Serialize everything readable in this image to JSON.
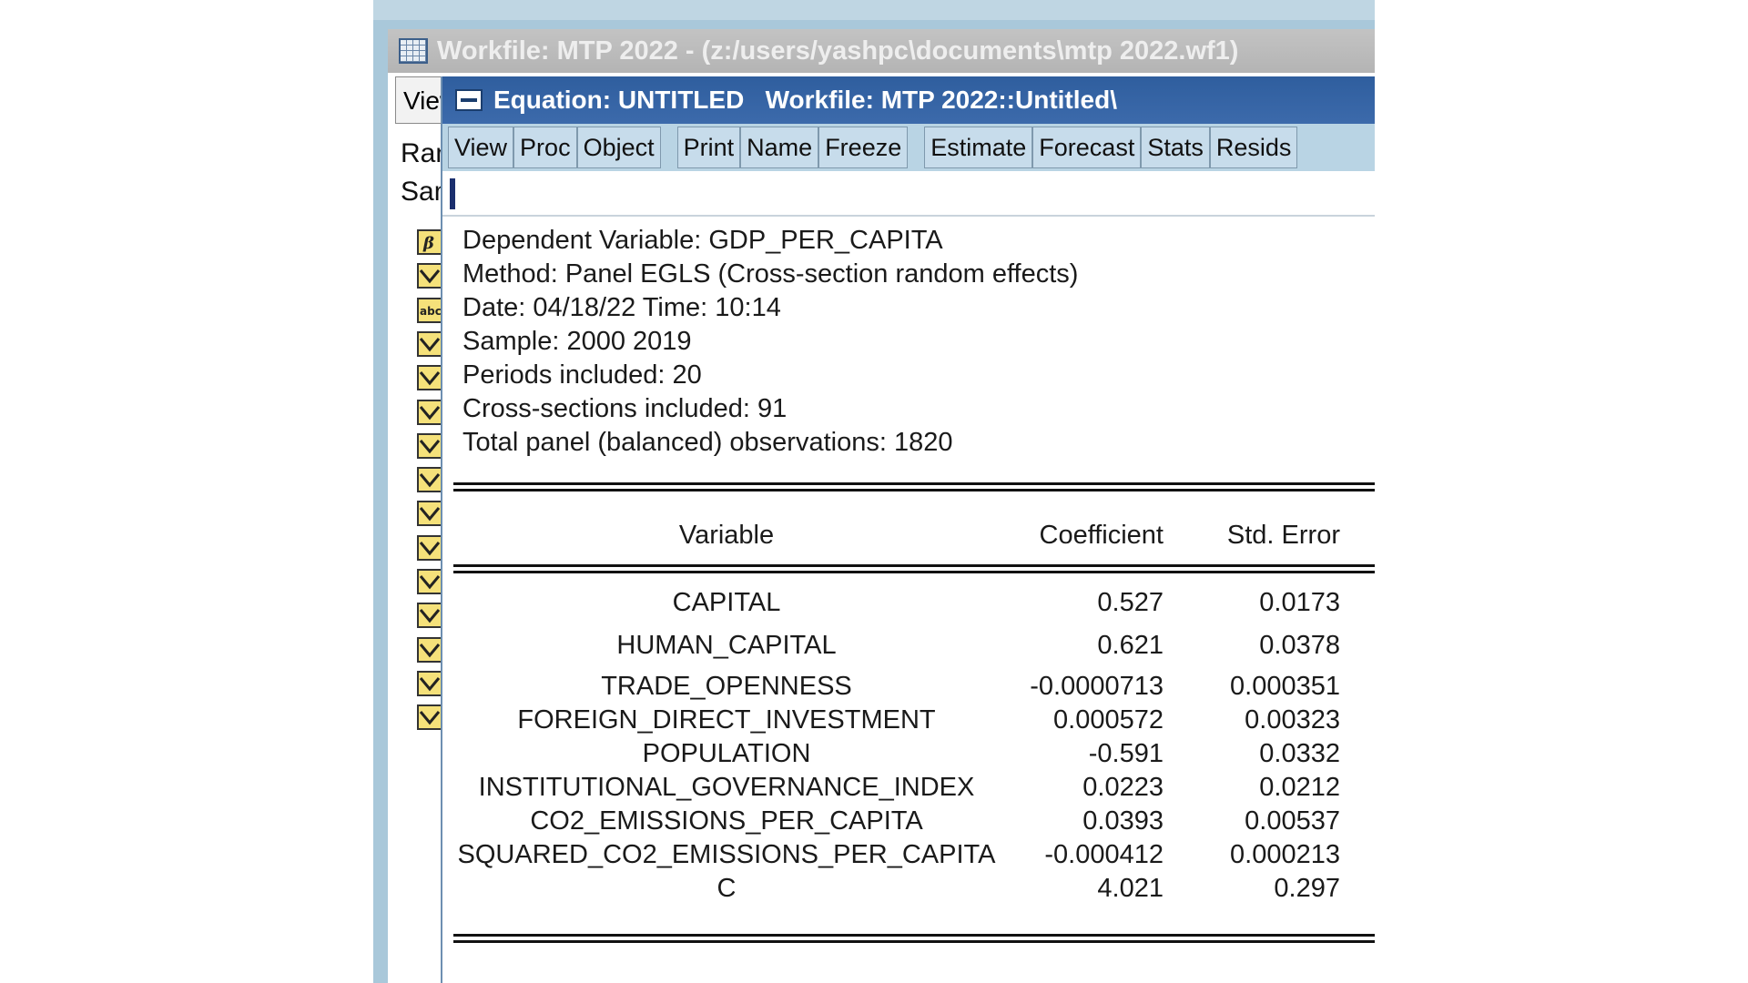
{
  "workfile": {
    "title": "Workfile: MTP 2022 - (z:/users/yashpc\\documents\\mtp 2022.wf1)",
    "view_label": "View",
    "range_label": "Range",
    "sample_label": "Sample"
  },
  "equation": {
    "title": "Equation: UNTITLED   Workfile: MTP 2022::Untitled\\",
    "toolbar": {
      "view": "View",
      "proc": "Proc",
      "object": "Object",
      "print": "Print",
      "name": "Name",
      "freeze": "Freeze",
      "estimate": "Estimate",
      "forecast": "Forecast",
      "stats": "Stats",
      "resids": "Resids"
    },
    "header": {
      "dependent": "Dependent Variable: GDP_PER_CAPITA",
      "method": "Method: Panel EGLS (Cross-section random effects)",
      "datetime": "Date: 04/18/22   Time: 10:14",
      "sample": "Sample: 2000 2019",
      "periods": "Periods included: 20",
      "cross_sections": "Cross-sections included: 91",
      "observations": "Total panel (balanced) observations: 1820"
    },
    "table": {
      "columns": [
        "Variable",
        "Coefficient",
        "Std. Error"
      ],
      "rows": [
        {
          "variable": "CAPITAL",
          "coefficient": "0.527",
          "std_error": "0.0173"
        },
        {
          "variable": "HUMAN_CAPITAL",
          "coefficient": "0.621",
          "std_error": "0.0378"
        },
        {
          "variable": "TRADE_OPENNESS",
          "coefficient": "-0.0000713",
          "std_error": "0.000351"
        },
        {
          "variable": "FOREIGN_DIRECT_INVESTMENT",
          "coefficient": "0.000572",
          "std_error": "0.00323"
        },
        {
          "variable": "POPULATION",
          "coefficient": "-0.591",
          "std_error": "0.0332"
        },
        {
          "variable": "INSTITUTIONAL_GOVERNANCE_INDEX",
          "coefficient": "0.0223",
          "std_error": "0.0212"
        },
        {
          "variable": "CO2_EMISSIONS_PER_CAPITA",
          "coefficient": "0.0393",
          "std_error": "0.00537"
        },
        {
          "variable": "SQUARED_CO2_EMISSIONS_PER_CAPITA",
          "coefficient": "-0.000412",
          "std_error": "0.000213"
        },
        {
          "variable": "C",
          "coefficient": "4.021",
          "std_error": "0.297"
        }
      ]
    }
  },
  "colors": {
    "title_active": "#3c6aab",
    "title_inactive": "#b4b4b4",
    "toolbar": "#b9d4e4",
    "window_frame": "#a9c8da"
  },
  "icons": {
    "workfile_title": "spreadsheet-icon",
    "equation_sysmenu": "system-menu-icon",
    "objects": [
      "coef-vector-icon",
      "series-icon",
      "alpha-series-icon",
      "series-icon",
      "series-icon",
      "series-icon",
      "series-icon",
      "series-icon",
      "series-icon",
      "series-icon",
      "series-icon",
      "series-icon",
      "series-icon",
      "series-icon",
      "series-icon"
    ]
  }
}
